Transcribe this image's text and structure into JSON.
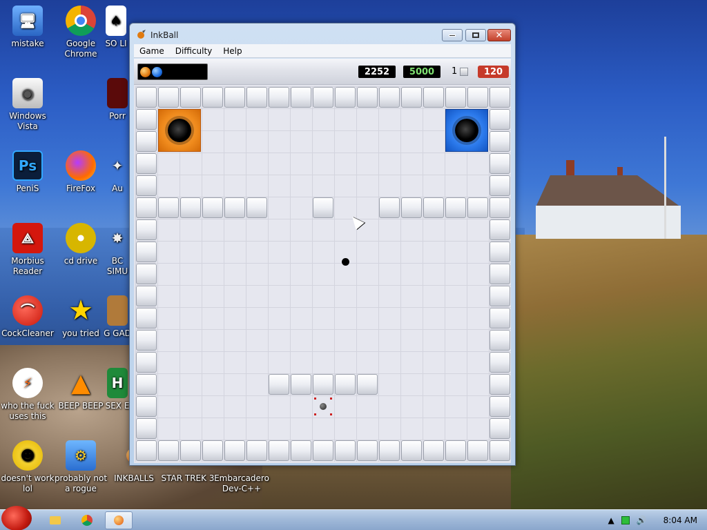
{
  "desktop": {
    "icons": [
      {
        "label": "mistake"
      },
      {
        "label": "Google Chrome"
      },
      {
        "label": "SO LI"
      },
      {
        "label": "Windows Vista"
      },
      {
        "label": "Porr"
      },
      {
        "label": "PeniS"
      },
      {
        "label": "FireFox"
      },
      {
        "label": "Au"
      },
      {
        "label": "Morbius Reader"
      },
      {
        "label": "cd drive"
      },
      {
        "label": "BC SIMU"
      },
      {
        "label": "CockCleaner"
      },
      {
        "label": "you tried"
      },
      {
        "label": "G GAD"
      },
      {
        "label": "who the fuck uses this"
      },
      {
        "label": "BEEP BEEP"
      },
      {
        "label": "SEX E"
      },
      {
        "label": "doesn't work lol"
      },
      {
        "label": "probably not a rogue"
      },
      {
        "label": "INKBALLS"
      },
      {
        "label": "STAR TREK 3"
      },
      {
        "label": "Embarcadero Dev-C++"
      }
    ]
  },
  "window": {
    "title": "InkBall",
    "menu": [
      "Game",
      "Difficulty",
      "Help"
    ],
    "controls": {
      "close_glyph": "✕"
    }
  },
  "hud": {
    "score": "2252",
    "target": "5000",
    "lives": "1",
    "timer": "120",
    "queue": [
      "orange",
      "blue"
    ]
  },
  "board": {
    "holes": [
      {
        "color": "orange",
        "col": 1,
        "row": 1
      },
      {
        "color": "blue",
        "col": 14,
        "row": 1
      }
    ]
  },
  "taskbar": {
    "clock": "8:04 AM",
    "icons": [
      "angry-bird-start-icon",
      "folder-icon",
      "chrome-icon",
      "inkball-icon"
    ]
  }
}
